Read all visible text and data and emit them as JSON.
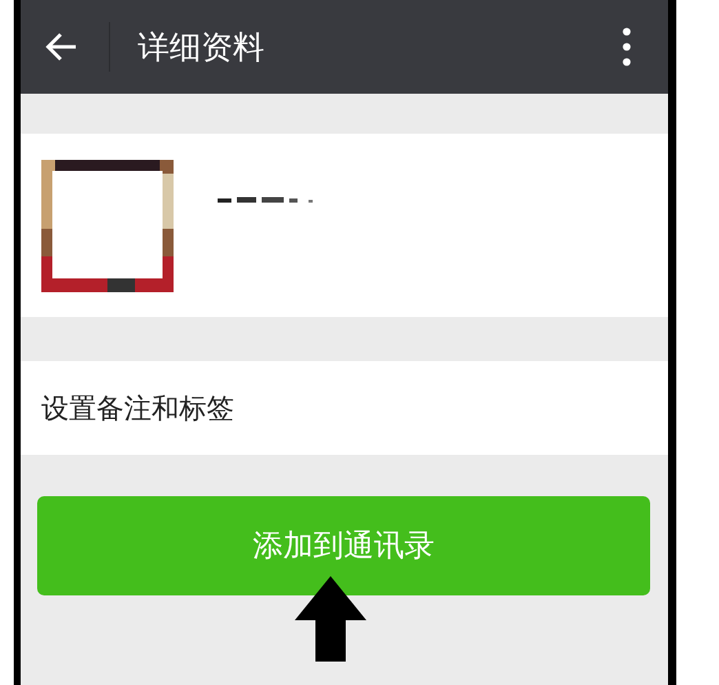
{
  "header": {
    "title": "详细资料"
  },
  "remark_row": {
    "label": "设置备注和标签"
  },
  "add_button": {
    "label": "添加到通讯录"
  }
}
